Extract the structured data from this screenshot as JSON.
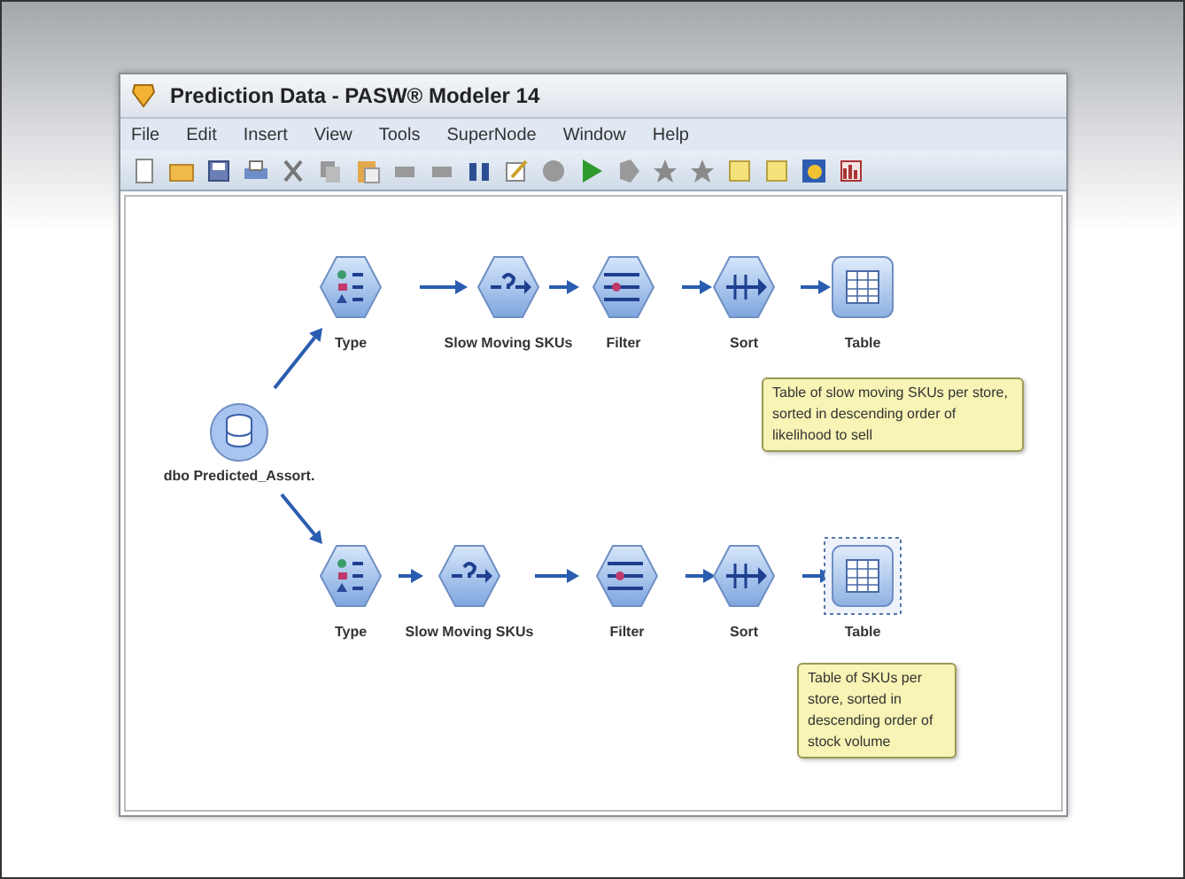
{
  "window": {
    "title": "Prediction Data - PASW® Modeler 14"
  },
  "menu": [
    "File",
    "Edit",
    "Insert",
    "View",
    "Tools",
    "SuperNode",
    "Window",
    "Help"
  ],
  "source": {
    "label": "dbo Predicted_Assort."
  },
  "streams": [
    {
      "nodes": [
        {
          "kind": "type",
          "label": "Type",
          "selected": false
        },
        {
          "kind": "select",
          "label": "Slow Moving SKUs",
          "selected": false
        },
        {
          "kind": "filter",
          "label": "Filter",
          "selected": false
        },
        {
          "kind": "sort",
          "label": "Sort",
          "selected": false
        },
        {
          "kind": "table",
          "label": "Table",
          "selected": false
        }
      ],
      "comment": "Table of slow moving SKUs per store, sorted in descending order of likelihood to sell"
    },
    {
      "nodes": [
        {
          "kind": "type",
          "label": "Type",
          "selected": false
        },
        {
          "kind": "select",
          "label": "Slow Moving SKUs",
          "selected": false
        },
        {
          "kind": "filter",
          "label": "Filter",
          "selected": false
        },
        {
          "kind": "sort",
          "label": "Sort",
          "selected": false
        },
        {
          "kind": "table",
          "label": "Table",
          "selected": true
        }
      ],
      "comment": "Table of SKUs per store, sorted in descending order of stock volume"
    }
  ]
}
